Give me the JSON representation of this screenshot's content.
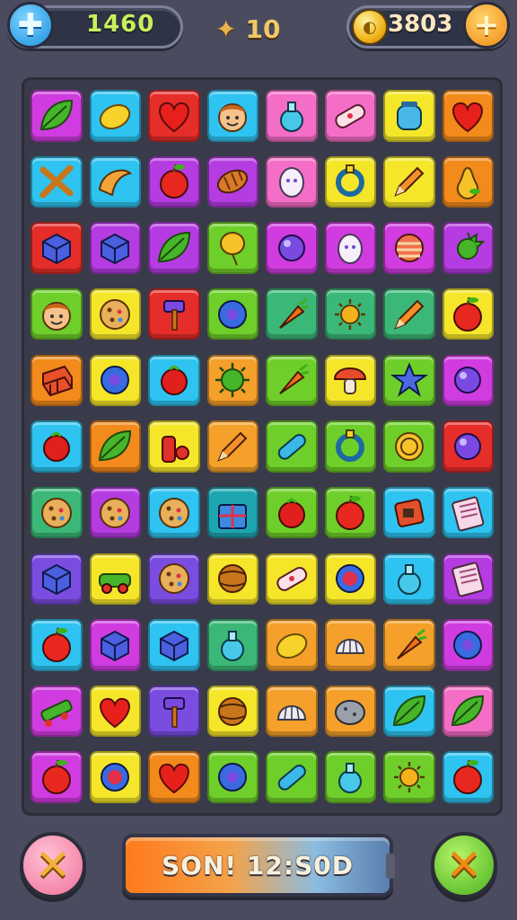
{
  "hud": {
    "left_button_icon": "plus-icon",
    "score": "1460",
    "moves_icon": "star-icon",
    "moves": "10",
    "coin_icon": "coin-icon",
    "coins": "3803",
    "right_button_icon": "plus-icon"
  },
  "board": {
    "rows": 11,
    "cols": 7,
    "tiles": [
      [
        {
          "color": "#d03ce0",
          "icon": "leaf"
        },
        {
          "color": "#2ec3f0",
          "icon": "lemon"
        },
        {
          "color": "#e52d2a",
          "icon": "heart"
        },
        {
          "color": "#2ec3f0",
          "icon": "face"
        },
        {
          "color": "#f46ec7",
          "icon": "potion"
        },
        {
          "color": "#f46ec7",
          "icon": "bandage"
        },
        {
          "color": "#f5e62a",
          "icon": "jar"
        },
        {
          "color": "#f28a1c",
          "icon": "heart"
        }
      ],
      [
        {
          "color": "#2ec3f0",
          "icon": "sticks"
        },
        {
          "color": "#2ec3f0",
          "icon": "croissant"
        },
        {
          "color": "#b43ce0",
          "icon": "apple"
        },
        {
          "color": "#b43ce0",
          "icon": "cocoon"
        },
        {
          "color": "#f46ec7",
          "icon": "egg"
        },
        {
          "color": "#f5e62a",
          "icon": "ring"
        },
        {
          "color": "#f5e62a",
          "icon": "pencil"
        },
        {
          "color": "#f28a1c",
          "icon": "pear"
        }
      ],
      [
        {
          "color": "#e52d2a",
          "icon": "cube"
        },
        {
          "color": "#b43ce0",
          "icon": "cube"
        },
        {
          "color": "#b43ce0",
          "icon": "leaf"
        },
        {
          "color": "#6fcf2a",
          "icon": "balloon"
        },
        {
          "color": "#d03ce0",
          "icon": "orb"
        },
        {
          "color": "#d03ce0",
          "icon": "egg"
        },
        {
          "color": "#d03ce0",
          "icon": "striped"
        },
        {
          "color": "#b43ce0",
          "icon": "spiky"
        }
      ],
      [
        {
          "color": "#6fcf2a",
          "icon": "face"
        },
        {
          "color": "#f5e62a",
          "icon": "cookie"
        },
        {
          "color": "#e52d2a",
          "icon": "hammer"
        },
        {
          "color": "#6fcf2a",
          "icon": "gear"
        },
        {
          "color": "#3bb878",
          "icon": "carrot"
        },
        {
          "color": "#3bb878",
          "icon": "sun"
        },
        {
          "color": "#3bb878",
          "icon": "pencil"
        },
        {
          "color": "#f5e62a",
          "icon": "apple"
        }
      ],
      [
        {
          "color": "#f28a1c",
          "icon": "bricks"
        },
        {
          "color": "#f5e62a",
          "icon": "gear"
        },
        {
          "color": "#2ec3f0",
          "icon": "berry"
        },
        {
          "color": "#f5a02a",
          "icon": "virus"
        },
        {
          "color": "#6fcf2a",
          "icon": "carrot"
        },
        {
          "color": "#f5e62a",
          "icon": "mushroom"
        },
        {
          "color": "#6fcf2a",
          "icon": "star"
        },
        {
          "color": "#d03ce0",
          "icon": "orb"
        }
      ],
      [
        {
          "color": "#2ec3f0",
          "icon": "berry"
        },
        {
          "color": "#f28a1c",
          "icon": "leaf"
        },
        {
          "color": "#f5e62a",
          "icon": "bottle"
        },
        {
          "color": "#f5a02a",
          "icon": "pencil"
        },
        {
          "color": "#6fcf2a",
          "icon": "capsule"
        },
        {
          "color": "#6fcf2a",
          "icon": "ring"
        },
        {
          "color": "#6fcf2a",
          "icon": "coin"
        },
        {
          "color": "#e52d2a",
          "icon": "orb"
        }
      ],
      [
        {
          "color": "#3bb878",
          "icon": "cookie"
        },
        {
          "color": "#b43ce0",
          "icon": "cookie"
        },
        {
          "color": "#2ec3f0",
          "icon": "cookie"
        },
        {
          "color": "#1ea6b0",
          "icon": "gift"
        },
        {
          "color": "#6fcf2a",
          "icon": "berry"
        },
        {
          "color": "#6fcf2a",
          "icon": "apple"
        },
        {
          "color": "#2ec3f0",
          "icon": "box"
        },
        {
          "color": "#2ec3f0",
          "icon": "notebook"
        }
      ],
      [
        {
          "color": "#7a4ce0",
          "icon": "cube"
        },
        {
          "color": "#f5e62a",
          "icon": "car"
        },
        {
          "color": "#7a4ce0",
          "icon": "cookie"
        },
        {
          "color": "#f5e62a",
          "icon": "ball"
        },
        {
          "color": "#f5e62a",
          "icon": "bandage"
        },
        {
          "color": "#f5e62a",
          "icon": "cake"
        },
        {
          "color": "#2ec3f0",
          "icon": "potion"
        },
        {
          "color": "#b43ce0",
          "icon": "notebook"
        }
      ],
      [
        {
          "color": "#2ec3f0",
          "icon": "apple"
        },
        {
          "color": "#d03ce0",
          "icon": "cube"
        },
        {
          "color": "#2ec3f0",
          "icon": "cube"
        },
        {
          "color": "#3bb878",
          "icon": "potion"
        },
        {
          "color": "#f5a02a",
          "icon": "lemon"
        },
        {
          "color": "#f5a02a",
          "icon": "shell"
        },
        {
          "color": "#f5a02a",
          "icon": "carrot"
        },
        {
          "color": "#d03ce0",
          "icon": "gear"
        }
      ],
      [
        {
          "color": "#d03ce0",
          "icon": "skate"
        },
        {
          "color": "#f5e62a",
          "icon": "heart"
        },
        {
          "color": "#7a4ce0",
          "icon": "hammer"
        },
        {
          "color": "#f5e62a",
          "icon": "ball"
        },
        {
          "color": "#f5a02a",
          "icon": "shell"
        },
        {
          "color": "#f5a02a",
          "icon": "rock"
        },
        {
          "color": "#2ec3f0",
          "icon": "leaf"
        },
        {
          "color": "#f46ec7",
          "icon": "leaf"
        }
      ],
      [
        {
          "color": "#d03ce0",
          "icon": "apple"
        },
        {
          "color": "#f5e62a",
          "icon": "cake"
        },
        {
          "color": "#f28a1c",
          "icon": "heart"
        },
        {
          "color": "#6fcf2a",
          "icon": "gear"
        },
        {
          "color": "#6fcf2a",
          "icon": "capsule"
        },
        {
          "color": "#6fcf2a",
          "icon": "potion"
        },
        {
          "color": "#6fcf2a",
          "icon": "sun"
        },
        {
          "color": "#2ec3f0",
          "icon": "apple"
        }
      ]
    ]
  },
  "footer": {
    "left_button_icon": "cross-icon",
    "banner_text": "SON! 12:S0D",
    "right_button_icon": "cross-icon"
  }
}
